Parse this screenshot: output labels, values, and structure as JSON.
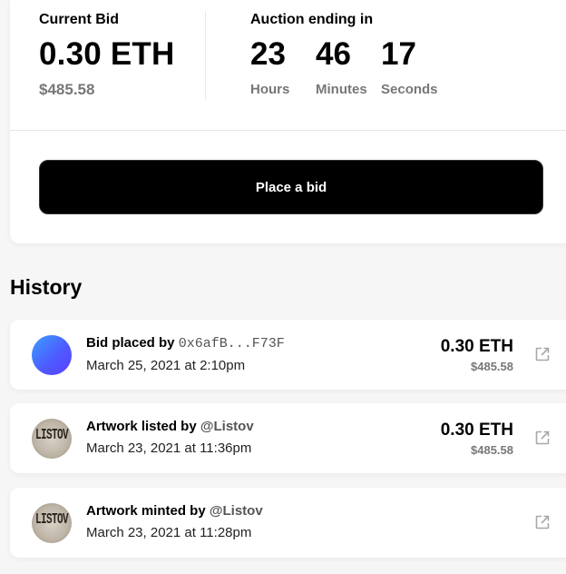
{
  "auction": {
    "current_bid_label": "Current Bid",
    "current_bid_eth": "0.30 ETH",
    "current_bid_usd": "$485.58",
    "ending_label": "Auction ending in",
    "hours": "23",
    "hours_label": "Hours",
    "minutes": "46",
    "minutes_label": "Minutes",
    "seconds": "17",
    "seconds_label": "Seconds",
    "place_bid_label": "Place a bid"
  },
  "history": {
    "title": "History",
    "items": [
      {
        "action": "Bid placed by",
        "actor": "0x6afB...F73F",
        "date": "March 25, 2021 at 2:10pm",
        "eth": "0.30 ETH",
        "usd": "$485.58",
        "avatar": "gradient-avatar"
      },
      {
        "action": "Artwork listed by",
        "actor": "@Listov",
        "date": "March 23, 2021 at 11:36pm",
        "eth": "0.30 ETH",
        "usd": "$485.58",
        "avatar": "listov-avatar",
        "avatar_text": "LISTOV"
      },
      {
        "action": "Artwork minted by",
        "actor": "@Listov",
        "date": "March 23, 2021 at 11:28pm",
        "avatar": "listov-avatar",
        "avatar_text": "LISTOV"
      }
    ]
  },
  "icons": {
    "external_link": "external-link-icon"
  },
  "colors": {
    "button_bg": "#000000",
    "muted_text": "#777777",
    "avatar_gradient_start": "#3aa0ff",
    "avatar_gradient_end": "#5b3dff"
  }
}
